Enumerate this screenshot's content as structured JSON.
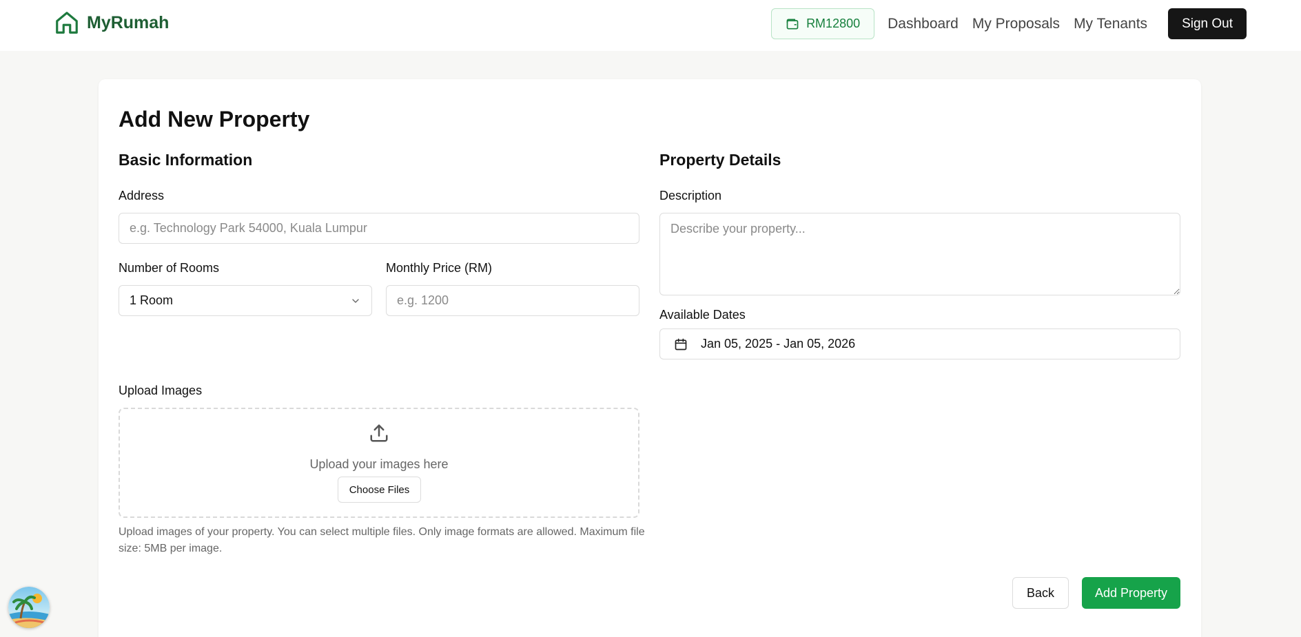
{
  "header": {
    "brand": "MyRumah",
    "brand_icon": "home-icon",
    "wallet_balance": "RM12800",
    "wallet_icon": "wallet-icon",
    "nav": [
      "Dashboard",
      "My Proposals",
      "My Tenants"
    ],
    "signout_label": "Sign Out"
  },
  "form": {
    "title": "Add New Property",
    "basic_section": "Basic Information",
    "details_section": "Property Details",
    "address_label": "Address",
    "address_placeholder": "e.g. Technology Park 54000, Kuala Lumpur",
    "rooms_label": "Number of Rooms",
    "rooms_value": "1 Room",
    "price_label": "Monthly Price (RM)",
    "price_placeholder": "e.g. 1200",
    "description_label": "Description",
    "description_placeholder": "Describe your property...",
    "dates_label": "Available Dates",
    "dates_value": "Jan 05, 2025 - Jan 05, 2026",
    "upload_label": "Upload Images",
    "upload_text": "Upload your images here",
    "choose_files_label": "Choose Files",
    "upload_hint": "Upload images of your property. You can select multiple files. Only image formats are allowed. Maximum file size: 5MB per image.",
    "back_label": "Back",
    "submit_label": "Add Property"
  },
  "colors": {
    "brand": "#1e5e33",
    "accent": "#16a34a",
    "dark_button": "#161616"
  }
}
